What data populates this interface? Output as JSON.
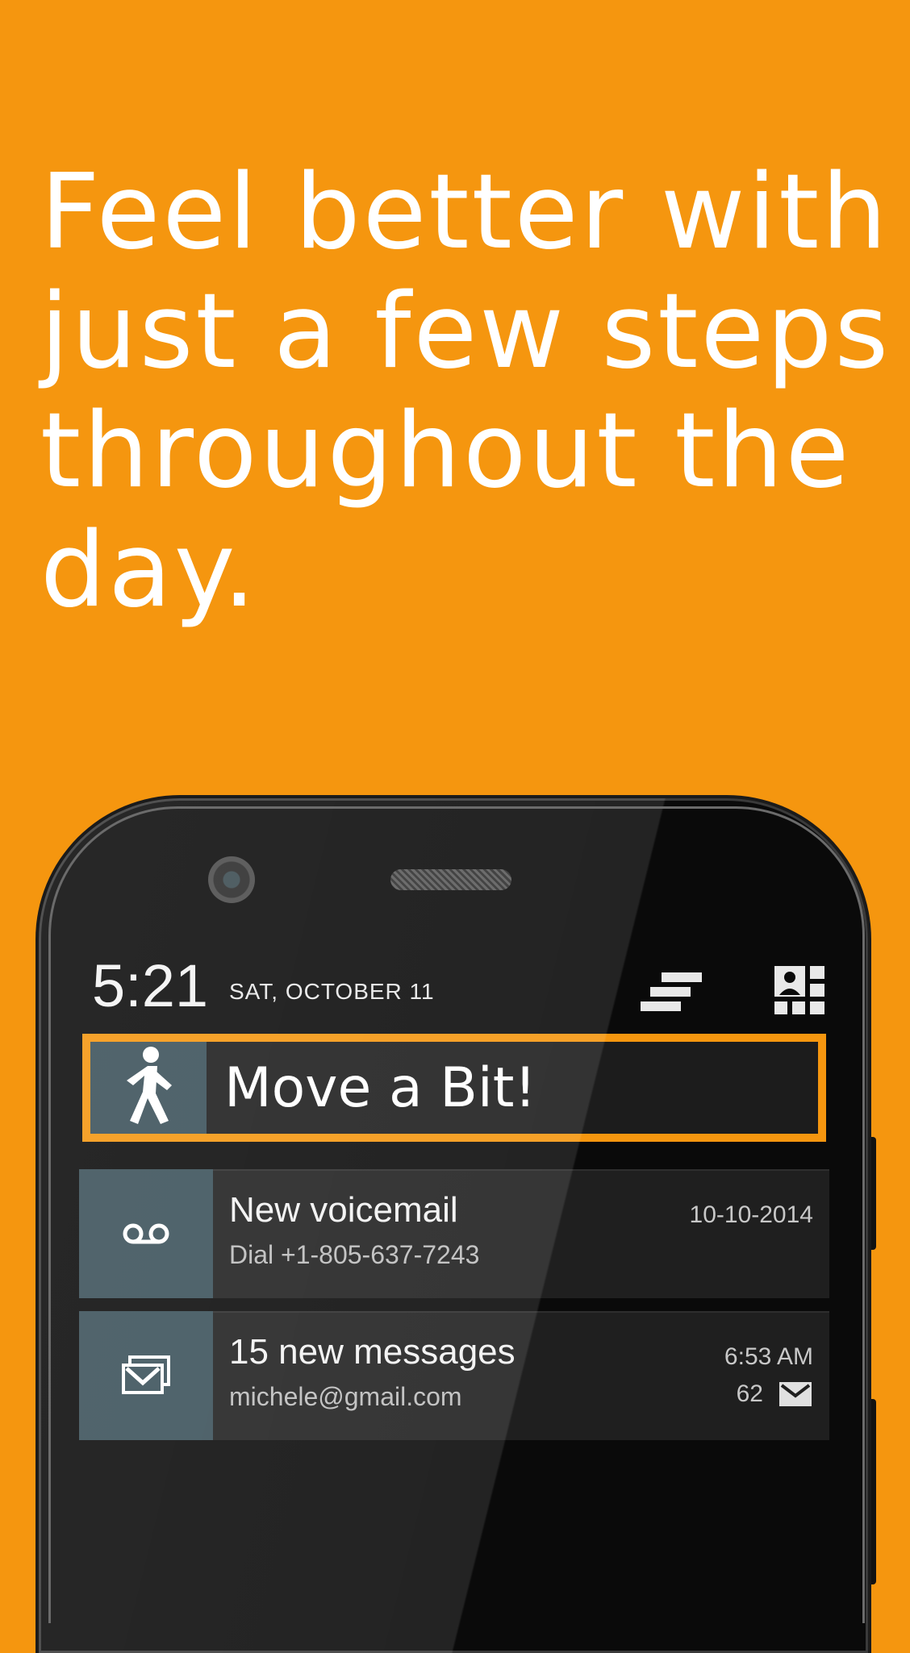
{
  "headline": "Feel better with just a few steps throughout the day.",
  "status_bar": {
    "time": "5:21",
    "date": "SAT, OCTOBER 11"
  },
  "quick_settings": {
    "clear_icon": "clear-notifications-icon",
    "settings_icon": "quick-settings-grid-icon"
  },
  "notifications": {
    "move": {
      "title": "Move a Bit!",
      "icon": "walking-person-icon",
      "highlight_color": "#f5960f"
    },
    "voicemail": {
      "title": "New voicemail",
      "subtitle": "Dial +1-805-637-7243",
      "date": "10-10-2014",
      "icon": "voicemail-icon"
    },
    "email": {
      "title": "15 new messages",
      "subtitle": "michele@gmail.com",
      "time": "6:53 AM",
      "count": "62",
      "icon": "gmail-icon"
    }
  },
  "colors": {
    "background": "#f5960f",
    "icon_tile": "#3a5059",
    "notification_bg": "#1f1f1f"
  }
}
